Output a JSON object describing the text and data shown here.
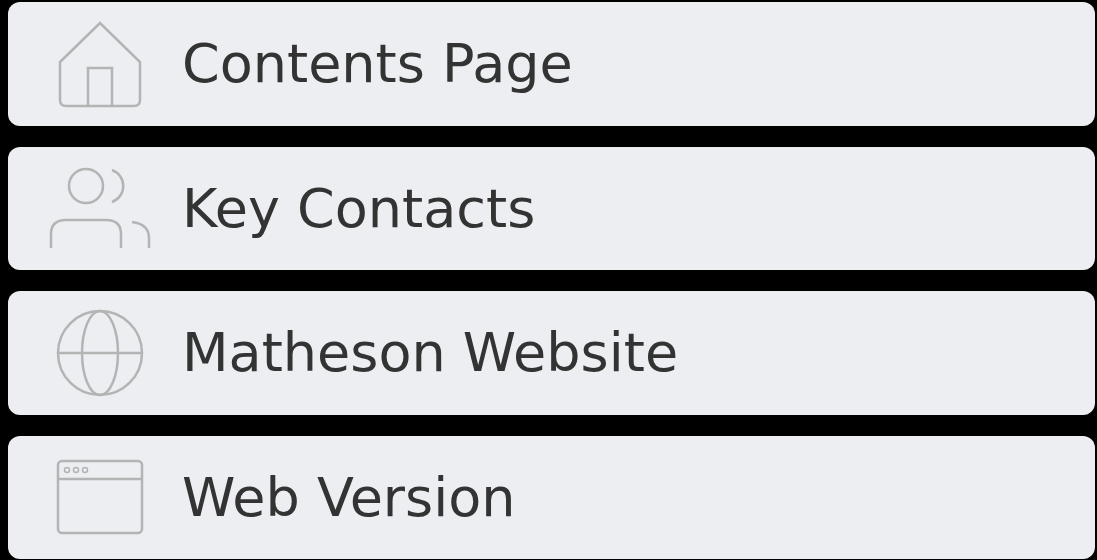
{
  "menu_items": [
    {
      "label": "Contents Page",
      "kind": "home"
    },
    {
      "label": "Key Contacts",
      "kind": "people"
    },
    {
      "label": "Matheson Website",
      "kind": "globe"
    },
    {
      "label": "Web Version",
      "kind": "browser"
    }
  ]
}
